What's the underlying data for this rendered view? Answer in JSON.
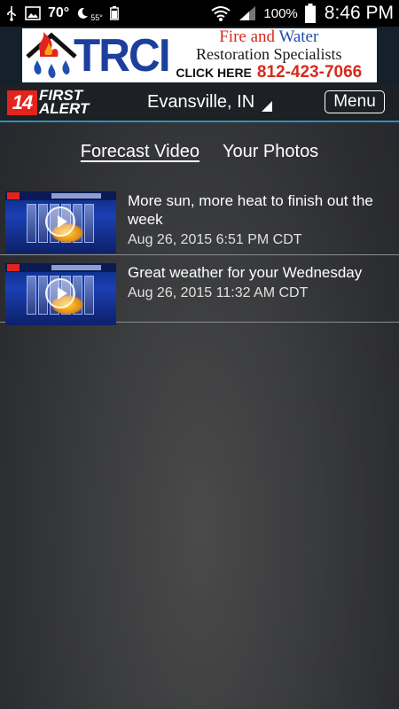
{
  "status_bar": {
    "temperature": "70°",
    "low_temperature": "55°",
    "battery_percent": "100%",
    "time": "8:46 PM"
  },
  "ad": {
    "brand": "TRCI",
    "line1_fire": "Fire and",
    "line1_water": "Water",
    "line2": "Restoration Specialists",
    "cta": "CLICK HERE",
    "phone": "812-423-7066"
  },
  "header": {
    "logo_number": "14",
    "logo_line1": "FIRST",
    "logo_line2": "ALERT",
    "location": "Evansville, IN",
    "menu_label": "Menu"
  },
  "tabs": [
    {
      "label": "Forecast Video",
      "active": true
    },
    {
      "label": "Your Photos",
      "active": false
    }
  ],
  "videos": [
    {
      "title": "More sun, more heat to finish out the week",
      "date": "Aug 26, 2015 6:51 PM CDT"
    },
    {
      "title": "Great weather for your Wednesday",
      "date": "Aug 26, 2015 11:32 AM CDT"
    }
  ],
  "colors": {
    "accent_line": "#2f8fbd",
    "logo_red": "#e3231d",
    "ad_blue": "#1c3f9e",
    "ad_red": "#d62a1e"
  }
}
